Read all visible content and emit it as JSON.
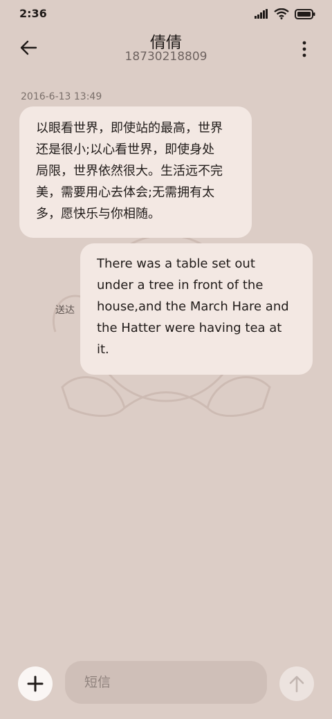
{
  "status_bar": {
    "time": "2:36",
    "icons": [
      "signal-icon",
      "wifi-icon",
      "battery-icon"
    ]
  },
  "header": {
    "contact_name": "倩倩",
    "contact_number": "18730218809",
    "back_icon": "back-arrow-icon",
    "more_icon": "more-vertical-icon"
  },
  "conversation": {
    "timestamp": "2016-6-13 13:49",
    "messages": [
      {
        "direction": "incoming",
        "lines": [
          "以眼看世界，即使站的最高，世界",
          "还是很小;以心看世界，即使身处",
          "局限，世界依然很大。生活远不完",
          "美，需要用心去体会;无需拥有太",
          "多，愿快乐与你相随。"
        ]
      },
      {
        "direction": "outgoing",
        "lines": [
          "There was a table set out",
          "under a tree in front of the",
          "house,and the March Hare and",
          "the Hatter were having tea at",
          "it."
        ],
        "status": "送达"
      }
    ]
  },
  "composer": {
    "placeholder": "短信",
    "value": "",
    "add_icon": "plus-icon",
    "send_icon": "send-arrow-icon"
  },
  "colors": {
    "background": "#dccdc6",
    "bubble": "#f3e8e3",
    "input": "#cfbfb8"
  }
}
